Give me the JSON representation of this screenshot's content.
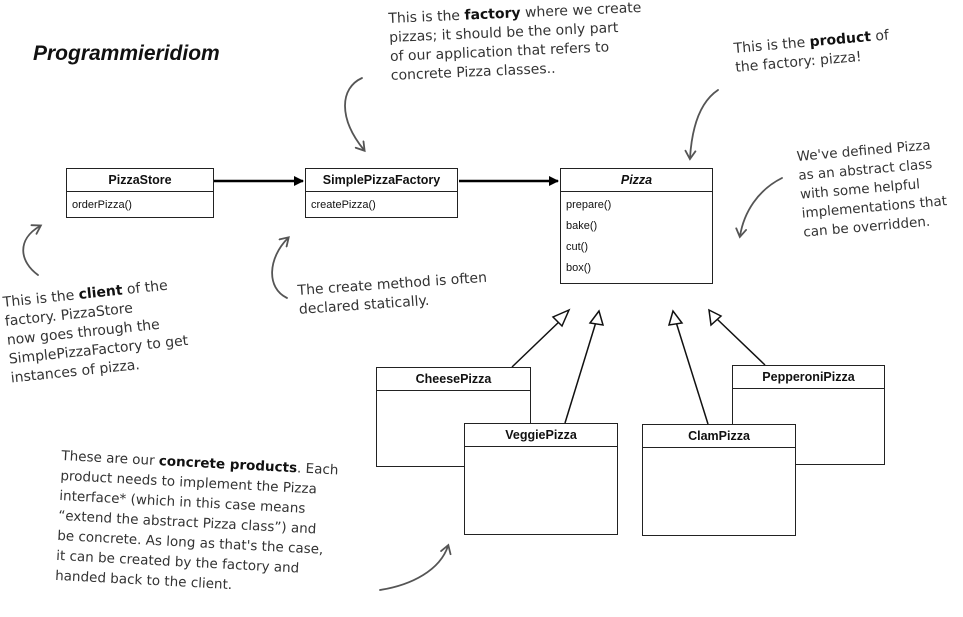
{
  "title": "Programmieridiom",
  "classes": {
    "pizza_store": {
      "name": "PizzaStore",
      "methods": [
        "orderPizza()"
      ]
    },
    "simple_pizza_factory": {
      "name": "SimplePizzaFactory",
      "methods": [
        "createPizza()"
      ]
    },
    "pizza": {
      "name": "Pizza",
      "methods": [
        "prepare()",
        "bake()",
        "cut()",
        "box()"
      ]
    },
    "cheese_pizza": {
      "name": "CheesePizza"
    },
    "veggie_pizza": {
      "name": "VeggiePizza"
    },
    "clam_pizza": {
      "name": "ClamPizza"
    },
    "pepperoni_pizza": {
      "name": "PepperoniPizza"
    }
  },
  "notes": {
    "factory": {
      "l1a": "This is the ",
      "l1b": "factory",
      "l1c": " where we create",
      "l2": "pizzas; it should be the only part",
      "l3": "of our application that refers to",
      "l4": "concrete Pizza classes.."
    },
    "product": {
      "l1a": "This is the ",
      "l1b": "product",
      "l1c": " of",
      "l2": "the factory: pizza!"
    },
    "abstract": {
      "l1": "We've defined Pizza",
      "l2": "as an abstract class",
      "l3": "with some helpful",
      "l4": "implementations that",
      "l5": "can be overridden."
    },
    "create_method": {
      "l1": "The create method is often",
      "l2": "declared statically."
    },
    "client": {
      "l1a": "This is the ",
      "l1b": "client",
      "l1c": " of the",
      "l2": "factory. PizzaStore",
      "l3": "now goes through the",
      "l4": "SimplePizzaFactory to get",
      "l5": "instances of pizza."
    },
    "concrete": {
      "l1a": "These are our ",
      "l1b": "concrete products",
      "l1c": ".  Each",
      "l2": "product needs to implement the Pizza",
      "l3": "interface* (which in this case means",
      "l4": "“extend the abstract Pizza class”) and",
      "l5": "be concrete.  As long as that's the case,",
      "l6": "it can be created by the factory and",
      "l7": "handed back to the client."
    }
  }
}
